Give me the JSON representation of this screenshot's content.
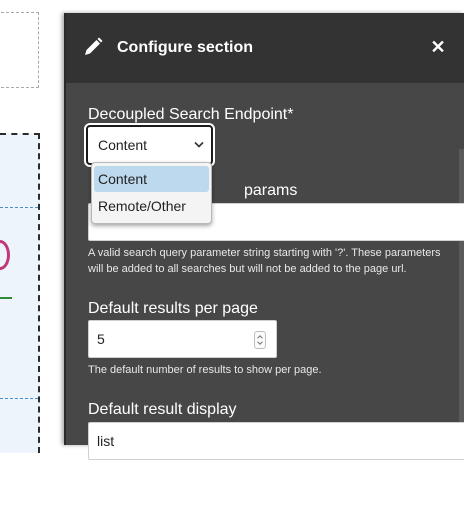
{
  "panel": {
    "title": "Configure section",
    "icons": {
      "edit": "pencil-icon",
      "close": "close-icon"
    }
  },
  "fields": {
    "endpoint": {
      "label": "Decoupled Search Endpoint*",
      "selected": "Content",
      "options": [
        "Content",
        "Remote/Other"
      ]
    },
    "params": {
      "label_partial": "params",
      "value": "",
      "description_line1": "A valid search query parameter string starting with '?'. These parameters",
      "description_line2": "will be added to all searches but will not be added to the page url."
    },
    "results_per_page": {
      "label": "Default results per page",
      "value": "5",
      "description": "The default number of results to show per page."
    },
    "result_display": {
      "label": "Default result display",
      "value": "list"
    }
  },
  "colors": {
    "panel_bg": "#474747",
    "header_bg": "#333333",
    "option_highlight": "#bcd9ee"
  }
}
